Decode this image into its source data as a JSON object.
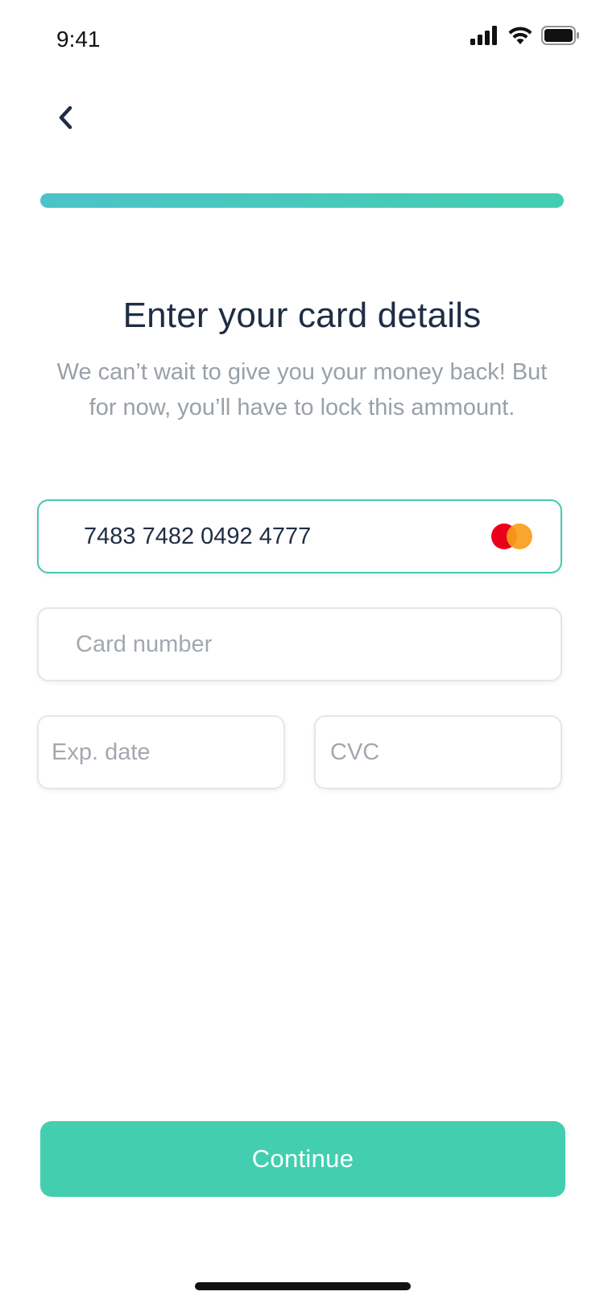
{
  "status_bar": {
    "time": "9:41",
    "icons": [
      "cellular-signal-icon",
      "wifi-icon",
      "battery-icon"
    ]
  },
  "nav": {
    "back_icon": "chevron-left-icon"
  },
  "progress": {
    "value_fraction": 1.0
  },
  "content": {
    "title": "Enter your card details",
    "subtitle": "We can’t wait to give you your money back! But for now, you’ll have to lock this ammount."
  },
  "form": {
    "card_active": {
      "value": "7483 7482 0492 4777",
      "brand_icon": "mastercard-icon"
    },
    "card_number": {
      "placeholder": "Card number",
      "value": ""
    },
    "exp_date": {
      "placeholder": "Exp. date",
      "value": ""
    },
    "cvc": {
      "placeholder": "CVC",
      "value": ""
    }
  },
  "actions": {
    "continue_label": "Continue"
  },
  "colors": {
    "accent": "#44ceb0",
    "progress_start": "#4bc3c8",
    "title_text": "#1f2d44",
    "muted_text": "#9aa0a8",
    "mastercard_red": "#eb001b",
    "mastercard_orange": "#f79e1b"
  }
}
